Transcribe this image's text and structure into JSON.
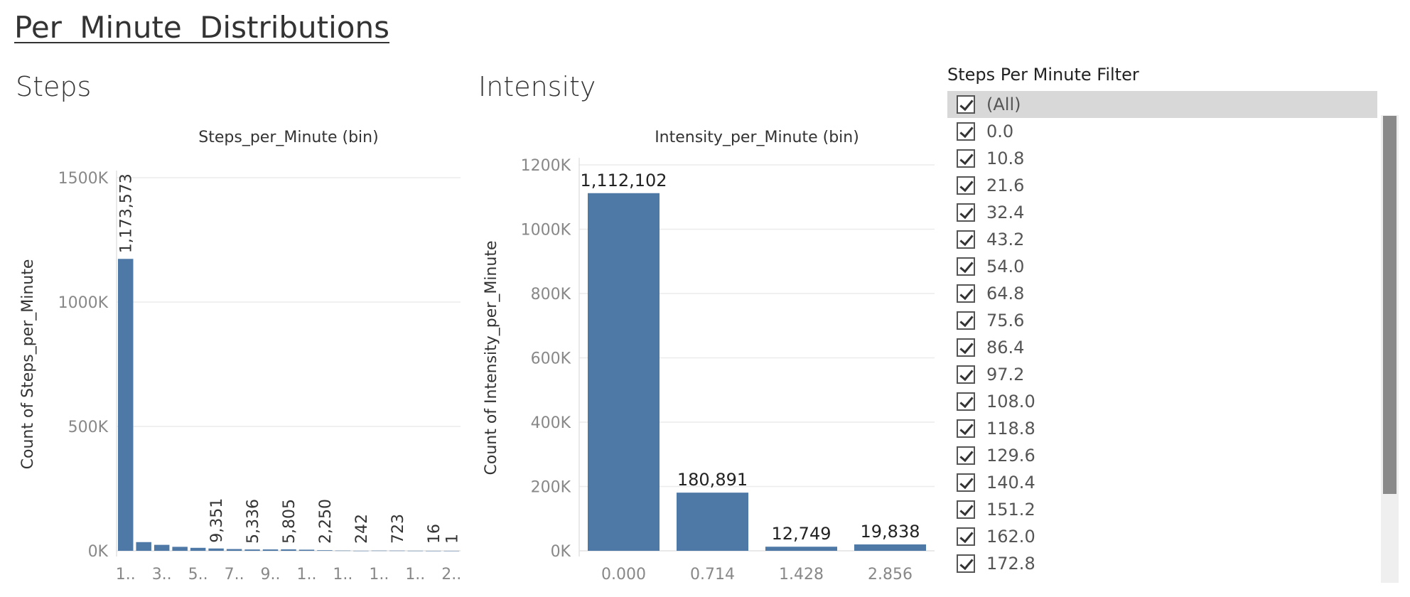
{
  "dashboard": {
    "title": "Per Minute Distributions"
  },
  "chart_data": [
    {
      "type": "bar",
      "sheet_title": "Steps",
      "title": "Steps_per_Minute (bin)",
      "ylabel": "Count of Steps_per_Minute",
      "ylim": [
        0,
        1500000
      ],
      "yticks": [
        "0K",
        "500K",
        "1000K",
        "1500K"
      ],
      "ytick_values": [
        0,
        500000,
        1000000,
        1500000
      ],
      "categories": [
        "1..",
        "",
        "3..",
        "",
        "5..",
        "",
        "7..",
        "",
        "9..",
        "",
        "1..",
        "",
        "1..",
        "",
        "1..",
        "",
        "1..",
        "",
        "2.."
      ],
      "values": [
        1173573,
        35000,
        24000,
        16000,
        12000,
        9351,
        7000,
        5336,
        5500,
        5805,
        4500,
        2250,
        900,
        242,
        800,
        723,
        300,
        16,
        1
      ],
      "labels": [
        "1,173,573",
        "",
        "",
        "",
        "",
        "9,351",
        "",
        "5,336",
        "",
        "5,805",
        "",
        "2,250",
        "",
        "242",
        "",
        "723",
        "",
        "16",
        "1"
      ],
      "color": "#4e79a7"
    },
    {
      "type": "bar",
      "sheet_title": "Intensity",
      "title": "Intensity_per_Minute (bin)",
      "ylabel": "Count of Intensity_per_Minute",
      "ylim": [
        0,
        1200000
      ],
      "yticks": [
        "0K",
        "200K",
        "400K",
        "600K",
        "800K",
        "1000K",
        "1200K"
      ],
      "ytick_values": [
        0,
        200000,
        400000,
        600000,
        800000,
        1000000,
        1200000
      ],
      "categories": [
        "0.000",
        "0.714",
        "1.428",
        "2.856"
      ],
      "values": [
        1112102,
        180891,
        12749,
        19838
      ],
      "labels": [
        "1,112,102",
        "180,891",
        "12,749",
        "19,838"
      ],
      "color": "#4e79a7"
    }
  ],
  "filter": {
    "title": "Steps Per Minute Filter",
    "items": [
      "(All)",
      "0.0",
      "10.8",
      "21.6",
      "32.4",
      "43.2",
      "54.0",
      "64.8",
      "75.6",
      "86.4",
      "97.2",
      "108.0",
      "118.8",
      "129.6",
      "140.4",
      "151.2",
      "162.0",
      "172.8"
    ]
  }
}
